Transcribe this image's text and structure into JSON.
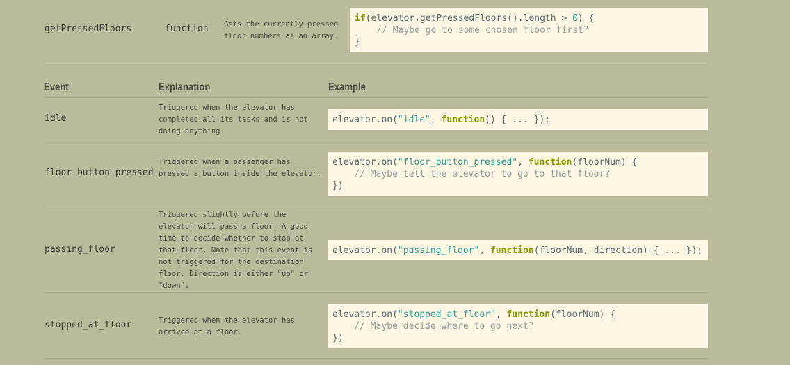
{
  "method": {
    "name": "getPressedFloors",
    "type": "function",
    "description": "Gets the currently pressed floor numbers as an array.",
    "code": {
      "line1_kw": "if",
      "line1_a": "(elevator.getPressedFloors().length > ",
      "line1_num": "0",
      "line1_b": ") {",
      "line2_comment": "    // Maybe go to some chosen floor first?",
      "line3": "}"
    }
  },
  "events_table": {
    "headers": {
      "event": "Event",
      "explanation": "Explanation",
      "example": "Example"
    },
    "rows": [
      {
        "event": "idle",
        "explanation": "Triggered when the elevator has completed all its tasks and is not doing anything.",
        "code": {
          "prefix": "elevator.on(",
          "str": "\"idle\"",
          "mid": ", ",
          "kw": "function",
          "suffix": "() { ... });"
        }
      },
      {
        "event": "floor_button_pressed",
        "explanation": "Triggered when a passenger has pressed a button inside the elevator.",
        "code": {
          "prefix": "elevator.on(",
          "str": "\"floor_button_pressed\"",
          "mid": ", ",
          "kw": "function",
          "suffix": "(floorNum) {",
          "comment": "    // Maybe tell the elevator to go to that floor?",
          "close": "})"
        }
      },
      {
        "event": "passing_floor",
        "explanation": "Triggered slightly before the elevator will pass a floor. A good time to decide whether to stop at that floor. Note that this event is not triggered for the destination floor. Direction is either \"up\" or \"down\".",
        "code": {
          "prefix": "elevator.on(",
          "str": "\"passing_floor\"",
          "mid": ", ",
          "kw": "function",
          "suffix": "(floorNum, direction) { ... });"
        }
      },
      {
        "event": "stopped_at_floor",
        "explanation": "Triggered when the elevator has arrived at a floor.",
        "code": {
          "prefix": "elevator.on(",
          "str": "\"stopped_at_floor\"",
          "mid": ", ",
          "kw": "function",
          "suffix": "(floorNum) {",
          "comment": "    // Maybe decide where to go next?",
          "close": "})"
        }
      }
    ]
  }
}
